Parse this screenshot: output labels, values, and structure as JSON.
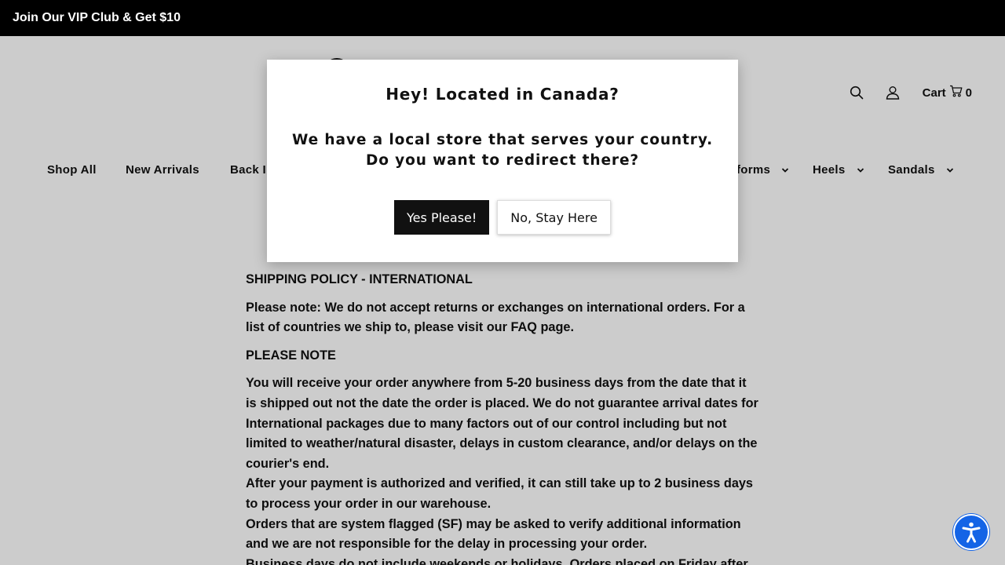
{
  "announcement": {
    "text": "Join Our VIP Club & Get $10"
  },
  "header": {
    "search_icon": "search-icon",
    "account_icon": "user-icon",
    "cart": {
      "label": "Cart",
      "count": "0",
      "icon": "cart-icon"
    }
  },
  "nav": {
    "items": [
      {
        "label": "Shop All"
      },
      {
        "label": "New Arrivals"
      },
      {
        "label": "Back I"
      },
      {
        "label": "forms"
      },
      {
        "label": "Heels"
      },
      {
        "label": "Sandals"
      }
    ]
  },
  "content": {
    "heading": "SHIPPING POLICY - INTERNATIONAL",
    "note": "Please note: We do not accept returns or exchanges on international orders. For a list of countries we ship to, please visit our FAQ page.",
    "please_note": "PLEASE NOTE",
    "para1": "You will receive your order anywhere from 5-20 business days from the date that it is shipped out not the date the order is placed. We do not guarantee arrival dates for International packages due to many factors out of our control including but not limited to weather/natural disaster, delays in custom clearance, and/or delays on the courier's end.",
    "para2": "After your payment is authorized and verified, it can still take up to 2 business days to process your order in our warehouse.",
    "para3": "Orders that are system flagged (SF) may be asked to verify additional information and we are not responsible for the delay in processing your order.",
    "para4": "Business days do not include weekends or holidays. Orders placed on Friday after"
  },
  "modal": {
    "title": "Hey! Located in Canada?",
    "line1": "We have a local store that serves your country.",
    "line2": "Do you want to redirect there?",
    "yes_label": "Yes Please!",
    "no_label": "No, Stay Here"
  },
  "accessibility": {
    "icon": "accessibility-icon"
  },
  "colors": {
    "overlay": "#cccccc",
    "accessibility_button": "#1464e6",
    "primary_button": "#111111"
  }
}
